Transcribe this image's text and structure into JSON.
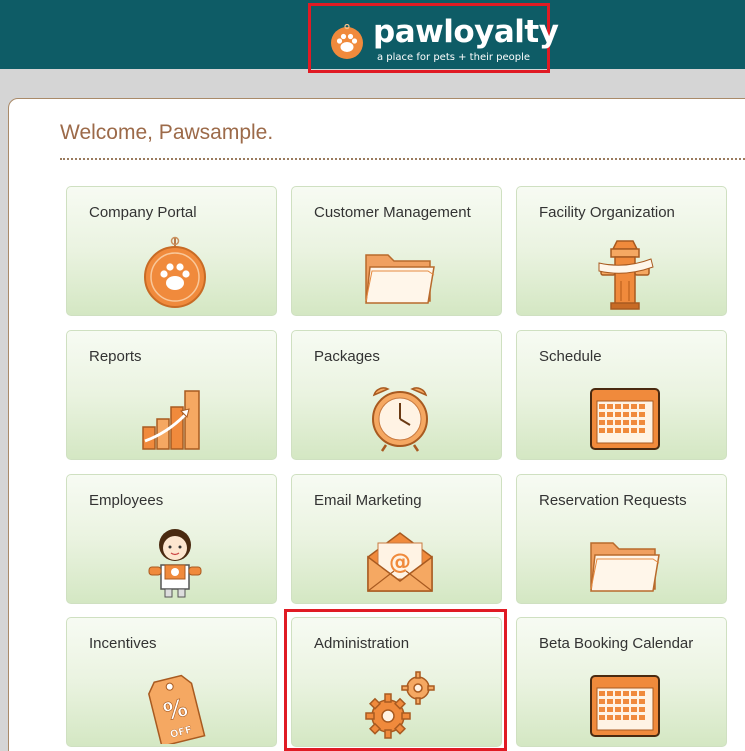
{
  "header": {
    "brand": "pawloyalty",
    "tagline": "a place for pets + their people"
  },
  "welcome": "Welcome, Pawsample.",
  "tiles": [
    {
      "label": "Company Portal",
      "icon": "paw-tag-icon"
    },
    {
      "label": "Customer Management",
      "icon": "folder-icon"
    },
    {
      "label": "Facility Organization",
      "icon": "fire-hydrant-icon"
    },
    {
      "label": "Reports",
      "icon": "bar-chart-icon"
    },
    {
      "label": "Packages",
      "icon": "alarm-clock-icon"
    },
    {
      "label": "Schedule",
      "icon": "calendar-icon"
    },
    {
      "label": "Employees",
      "icon": "employee-icon"
    },
    {
      "label": "Email Marketing",
      "icon": "email-icon"
    },
    {
      "label": "Reservation Requests",
      "icon": "folder-icon"
    },
    {
      "label": "Incentives",
      "icon": "discount-tag-icon"
    },
    {
      "label": "Administration",
      "icon": "gears-icon"
    },
    {
      "label": "Beta Booking Calendar",
      "icon": "calendar-icon"
    }
  ],
  "colors": {
    "header_bg": "#0e5c66",
    "accent_orange": "#f08a3c",
    "welcome_text": "#9c6a49",
    "highlight_red": "#e01b24"
  }
}
